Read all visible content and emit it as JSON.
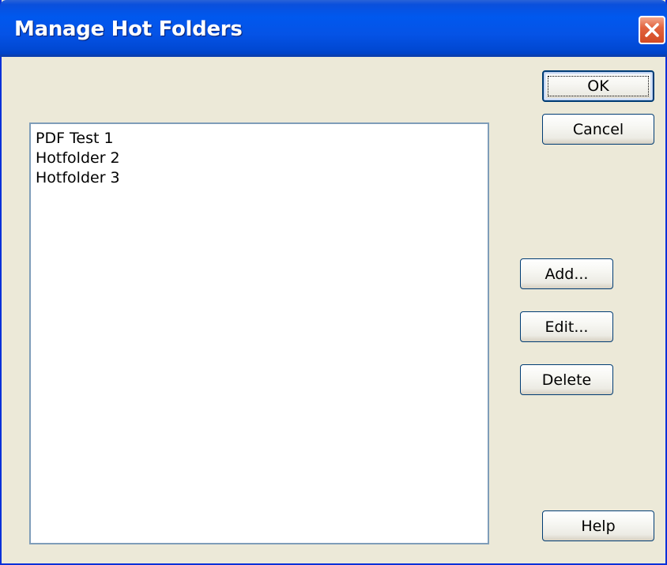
{
  "window": {
    "title": "Manage Hot Folders",
    "close_icon": "close-icon",
    "accent_color": "#0058ee",
    "close_color": "#d24a24"
  },
  "list": {
    "items": [
      "PDF Test 1",
      "Hotfolder 2",
      "Hotfolder 3"
    ]
  },
  "buttons": {
    "ok": "OK",
    "cancel": "Cancel",
    "add": "Add...",
    "edit": "Edit...",
    "delete": "Delete",
    "help": "Help"
  }
}
